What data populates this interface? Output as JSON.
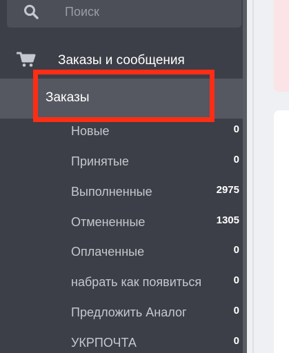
{
  "search": {
    "placeholder": "Поиск",
    "icon": "search-icon"
  },
  "section": {
    "title": "Заказы и сообщения",
    "icon": "cart-icon"
  },
  "active_item": {
    "label": "Заказы"
  },
  "sub_items": [
    {
      "label": "Новые",
      "count": "0"
    },
    {
      "label": "Принятые",
      "count": "0"
    },
    {
      "label": "Выполненные",
      "count": "2975"
    },
    {
      "label": "Отмененные",
      "count": "1305"
    },
    {
      "label": "Оплаченные",
      "count": "0"
    },
    {
      "label": "набрать как появиться",
      "count": "0"
    },
    {
      "label": "Предложить Аналог",
      "count": "0"
    },
    {
      "label": "УКРПОЧТА",
      "count": "0"
    }
  ],
  "colors": {
    "sidebar_bg": "#3c3f47",
    "active_bg": "#555860",
    "highlight": "#ff2d16"
  }
}
